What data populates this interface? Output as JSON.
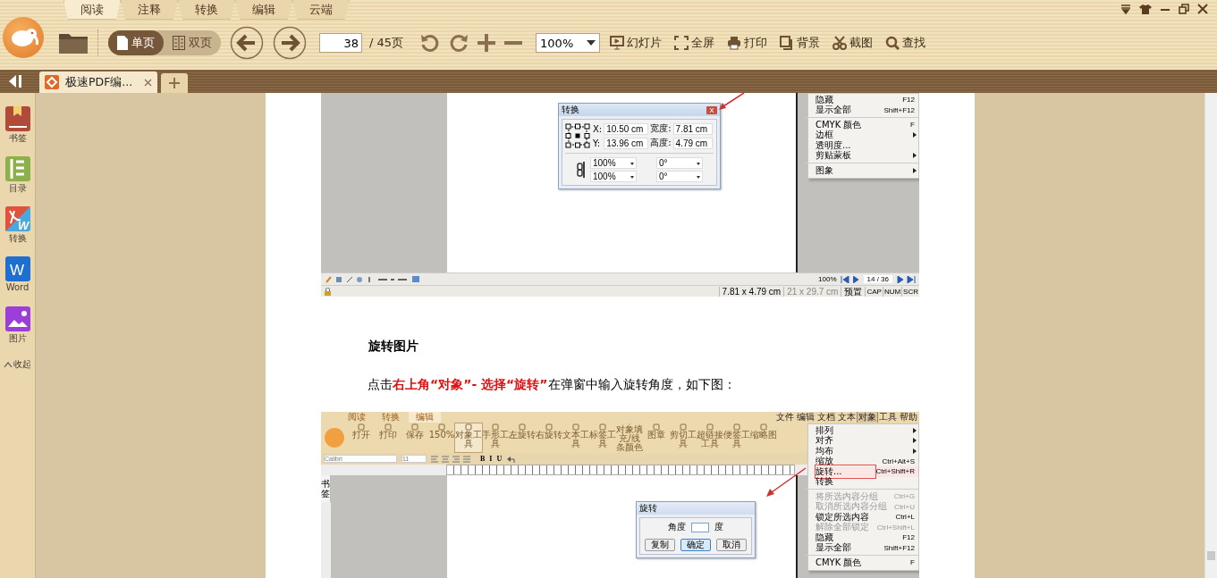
{
  "title_tabs": [
    {
      "label": "阅读",
      "selected": true
    },
    {
      "label": "注释",
      "selected": false
    },
    {
      "label": "转换",
      "selected": false
    },
    {
      "label": "编辑",
      "selected": false
    },
    {
      "label": "云端",
      "selected": false
    }
  ],
  "view_modes": [
    {
      "label": "单页",
      "kind": "single",
      "selected": true
    },
    {
      "label": "双页",
      "kind": "double",
      "selected": false
    }
  ],
  "page_number": "38",
  "page_total": "/ 45页",
  "zoom": "100%",
  "tools": [
    {
      "label": "幻灯片",
      "kind": "slideshow"
    },
    {
      "label": "全屏",
      "kind": "fullscreen"
    },
    {
      "label": "打印",
      "kind": "print"
    },
    {
      "label": "背景",
      "kind": "background"
    },
    {
      "label": "截图",
      "kind": "screenshot"
    },
    {
      "label": "查找",
      "kind": "search"
    }
  ],
  "document_tabs": [
    {
      "title": "极速PDF编...",
      "selected": true
    }
  ],
  "sidebar": {
    "items": [
      {
        "label": "书签",
        "kind": "bookmark"
      },
      {
        "label": "目录",
        "kind": "contents"
      },
      {
        "label": "转换",
        "kind": "convert",
        "icon_text": "W"
      },
      {
        "label": "Word",
        "kind": "word",
        "icon_text": "W"
      },
      {
        "label": "图片",
        "kind": "image"
      }
    ],
    "collapse": "收起"
  },
  "page": {
    "screenshot_1": {
      "dialog": {
        "title": "转换",
        "x_label": "X:",
        "x": "10.50 cm",
        "y_label": "Y:",
        "y": "13.96 cm",
        "width_label": "宽度:",
        "width": "7.81 cm",
        "height_label": "高度:",
        "height": "4.79 cm",
        "scale_h": "100%",
        "scale_v": "100%",
        "rotate": "0°",
        "skew": "0°"
      },
      "menu": [
        {
          "kind": "item",
          "label": "隐藏",
          "shortcut": "F12",
          "submenu": false
        },
        {
          "kind": "item",
          "label": "显示全部",
          "shortcut": "Shift+F12",
          "submenu": false
        },
        {
          "kind": "separator"
        },
        {
          "kind": "item",
          "label": "CMYK 颜色",
          "shortcut": "F",
          "submenu": false
        },
        {
          "kind": "item",
          "label": "边框",
          "submenu": true
        },
        {
          "kind": "item",
          "label": "透明度...",
          "submenu": false
        },
        {
          "kind": "item",
          "label": "剪贴蒙板",
          "submenu": true
        },
        {
          "kind": "separator"
        },
        {
          "kind": "item",
          "label": "图象",
          "submenu": true
        }
      ],
      "zoom": "100%",
      "page": "14 / 36",
      "size": "7.81 x 4.79 cm",
      "paper": "21 x 29.7 cm",
      "mode": "预置",
      "indicators": [
        "CAP",
        "NUM",
        "SCR"
      ]
    },
    "heading": "旋转图片",
    "paragraph": "点击**右上角“对象”- 选择“旋转”**在弹窗中输入旋转角度，如下图：",
    "screenshot_2": {
      "tabs": [
        {
          "label": "阅读",
          "selected": false
        },
        {
          "label": "转换",
          "selected": false
        },
        {
          "label": "编辑",
          "selected": true
        }
      ],
      "menubar": [
        {
          "label": "文件",
          "selected": false
        },
        {
          "label": "编辑",
          "selected": false
        },
        {
          "label": "文档",
          "selected": false
        },
        {
          "label": "文本",
          "selected": false
        },
        {
          "label": "对象",
          "selected": true
        },
        {
          "label": "工具",
          "selected": false
        },
        {
          "label": "帮助",
          "selected": false
        }
      ],
      "tools": [
        {
          "label": "打开",
          "selected": false
        },
        {
          "label": "打印",
          "selected": false
        },
        {
          "label": "保存",
          "selected": false
        },
        {
          "label": "150%",
          "selected": false
        },
        {
          "label": "对象工具",
          "selected": true
        },
        {
          "label": "手形工具",
          "selected": false
        },
        {
          "label": "左旋转",
          "selected": false
        },
        {
          "label": "右旋转",
          "selected": false
        },
        {
          "label": "文本工具",
          "selected": false
        },
        {
          "label": "标签工具",
          "selected": false
        },
        {
          "label": "对象填充/线条颜色",
          "selected": false
        },
        {
          "label": "图章",
          "selected": false
        },
        {
          "label": "剪切工具",
          "selected": false
        },
        {
          "label": "超链接工具",
          "selected": false
        },
        {
          "label": "便签工具",
          "selected": false
        },
        {
          "label": "缩略图",
          "selected": false
        }
      ],
      "font": "Calibri",
      "font_size": "11",
      "format_buttons": [
        "B",
        "I",
        "U"
      ],
      "side_tab": "书签",
      "menu": [
        {
          "kind": "item",
          "label": "排列",
          "submenu": true,
          "disabled": false,
          "selected": false
        },
        {
          "kind": "item",
          "label": "对齐",
          "submenu": true,
          "disabled": false,
          "selected": false
        },
        {
          "kind": "item",
          "label": "均布",
          "submenu": true,
          "disabled": false,
          "selected": false
        },
        {
          "kind": "item",
          "label": "缩放",
          "shortcut": "Ctrl+Alt+S",
          "submenu": false,
          "disabled": false,
          "selected": false
        },
        {
          "kind": "item",
          "label": "旋转...",
          "shortcut": "Ctrl+Shift+R",
          "submenu": false,
          "disabled": false,
          "selected": true
        },
        {
          "kind": "item",
          "label": "转换",
          "submenu": false,
          "disabled": false,
          "selected": false
        },
        {
          "kind": "separator"
        },
        {
          "kind": "item",
          "label": "将所选内容分组",
          "shortcut": "Ctrl+G",
          "submenu": false,
          "disabled": true,
          "selected": false
        },
        {
          "kind": "item",
          "label": "取消所选内容分组",
          "shortcut": "Ctrl+U",
          "submenu": false,
          "disabled": true,
          "selected": false
        },
        {
          "kind": "item",
          "label": "锁定所选内容",
          "shortcut": "Ctrl+L",
          "submenu": false,
          "disabled": false,
          "selected": false
        },
        {
          "kind": "item",
          "label": "解除全部锁定",
          "shortcut": "Ctrl+Shift+L",
          "submenu": false,
          "disabled": true,
          "selected": false
        },
        {
          "kind": "item",
          "label": "隐藏",
          "shortcut": "F12",
          "submenu": false,
          "disabled": false,
          "selected": false
        },
        {
          "kind": "item",
          "label": "显示全部",
          "shortcut": "Shift+F12",
          "submenu": false,
          "disabled": false,
          "selected": false
        },
        {
          "kind": "separator"
        },
        {
          "kind": "item",
          "label": "CMYK 颜色",
          "shortcut": "F",
          "submenu": false,
          "disabled": false,
          "selected": false
        }
      ],
      "dialog": {
        "title": "旋转",
        "label": "角度",
        "unit": "度",
        "buttons": [
          {
            "label": "复制",
            "selected": false
          },
          {
            "label": "确定",
            "selected": true
          },
          {
            "label": "取消",
            "selected": false
          }
        ]
      }
    }
  }
}
